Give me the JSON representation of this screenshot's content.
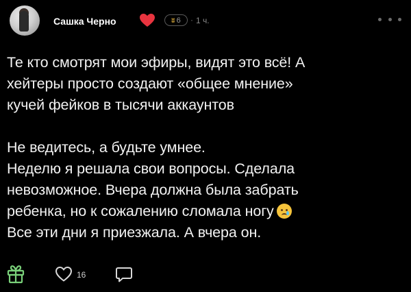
{
  "post": {
    "author": {
      "name": "Сашка Черно",
      "avatar": "avatar-photo"
    },
    "badge": {
      "icon": "bronze-rank-icon",
      "level": "6"
    },
    "separator": "·",
    "time": "1 ч.",
    "more": "more-icon",
    "text_lines": [
      "Те кто смотрят мои эфиры, видят это всё! А",
      "хейтеры просто создают «общее мнение»",
      "кучей фейков в тысячи аккаунтов",
      "",
      "Не ведитесь, а будьте умнее.",
      "Неделю я решала свои вопросы. Сделала",
      "невозможное. Вчера должна была забрать",
      "ребенка, но к сожалению сломала ногу",
      "Все эти дни я приезжала. А вчера он."
    ],
    "emoji": "crying-face-emoji",
    "actions": {
      "gift": "gift-icon",
      "like": "heart-outline-icon",
      "like_count": "16",
      "comment": "comment-icon"
    }
  },
  "colors": {
    "background": "#000000",
    "text": "#f2f2f2",
    "muted": "#8a8a8a",
    "heart": "#e8343f",
    "badge_gold": "#e3b23c",
    "gift_green": "#7ad17a"
  }
}
